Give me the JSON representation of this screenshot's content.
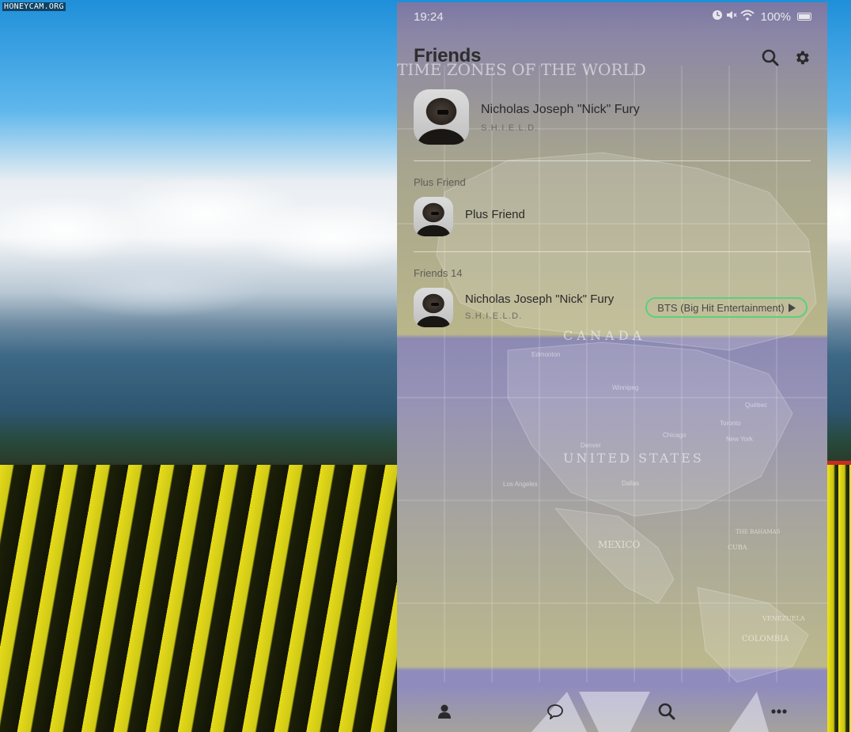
{
  "watermark": "HONEYCAM.ORG",
  "status_bar": {
    "time": "19:24",
    "battery": "100%"
  },
  "header": {
    "title": "Friends"
  },
  "my_profile": {
    "name": "Nicholas Joseph \"Nick\" Fury",
    "status": "S.H.I.E.L.D."
  },
  "plus_friend_section": {
    "label": "Plus Friend",
    "item_name": "Plus Friend"
  },
  "friends_section": {
    "label": "Friends 14",
    "items": [
      {
        "name": "Nicholas Joseph \"Nick\" Fury",
        "status": "S.H.I.E.L.D.",
        "music": "BTS (Big Hit Entertainment)"
      }
    ]
  },
  "map_labels": {
    "time_zones": "TIME ZONES OF THE WORLD",
    "canada": "C A N A D A",
    "united_states": "UNITED STATES",
    "mexico": "MEXICO",
    "colombia": "COLOMBIA",
    "venezuela": "VENEZUELA",
    "edmonton": "Edmonton",
    "winnipeg": "Winnipeg",
    "quebec": "Québec",
    "toronto": "Toronto",
    "chicago": "Chicago",
    "new_york": "New York",
    "denver": "Denver",
    "dallas": "Dallas",
    "los_angeles": "Los Angeles",
    "cuba": "CUBA",
    "the_bahamas": "THE BAHAMAS"
  },
  "bottom_nav": {
    "items": [
      "friends",
      "chats",
      "search",
      "more"
    ]
  }
}
